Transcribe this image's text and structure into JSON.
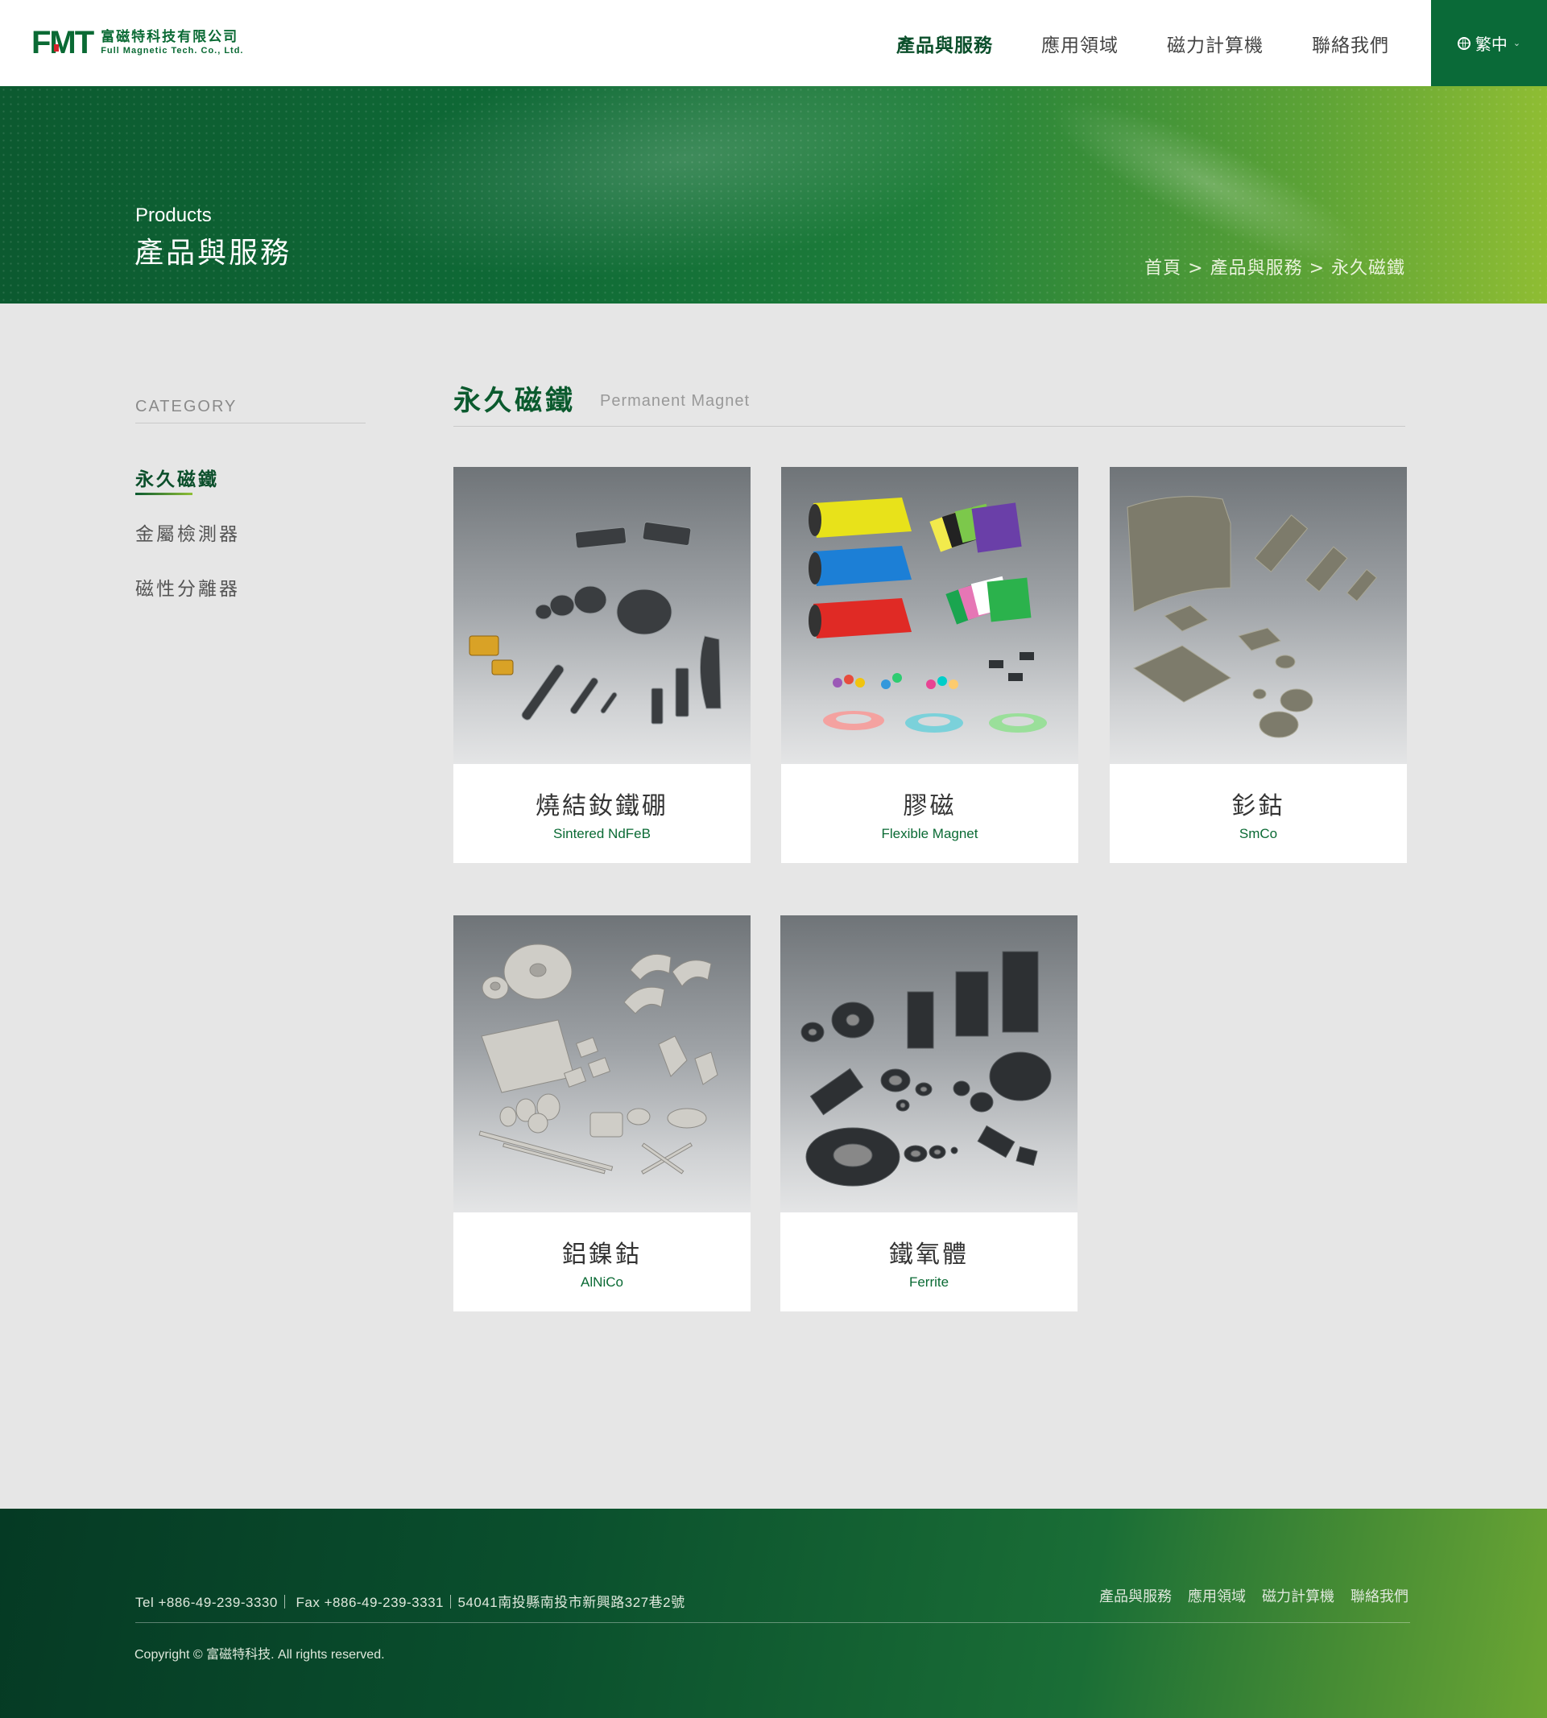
{
  "header": {
    "logo_mark": "FMT",
    "logo_cn": "富磁特科技有限公司",
    "logo_en": "Full Magnetic Tech. Co., Ltd.",
    "nav": [
      {
        "label": "產品與服務",
        "active": true
      },
      {
        "label": "應用領域",
        "active": false
      },
      {
        "label": "磁力計算機",
        "active": false
      },
      {
        "label": "聯絡我們",
        "active": false
      }
    ],
    "language": "繁中"
  },
  "banner": {
    "title_en": "Products",
    "title_cn": "產品與服務",
    "breadcrumb": "首頁 > 產品與服務 > 永久磁鐵"
  },
  "sidebar": {
    "title": "CATEGORY",
    "items": [
      {
        "label": "永久磁鐵",
        "active": true
      },
      {
        "label": "金屬檢測器",
        "active": false
      },
      {
        "label": "磁性分離器",
        "active": false
      }
    ]
  },
  "main": {
    "title_cn": "永久磁鐵",
    "title_en": "Permanent Magnet",
    "products": [
      {
        "cn": "燒結釹鐵硼",
        "en": "Sintered NdFeB"
      },
      {
        "cn": "膠磁",
        "en": "Flexible Magnet"
      },
      {
        "cn": "釤鈷",
        "en": "SmCo"
      },
      {
        "cn": "鋁鎳鈷",
        "en": "AlNiCo"
      },
      {
        "cn": "鐵氧體",
        "en": "Ferrite"
      }
    ]
  },
  "footer": {
    "contact": "Tel +886-49-239-3330｜ Fax +886-49-239-3331｜54041南投縣南投市新興路327巷2號",
    "nav": [
      "產品與服務",
      "應用領域",
      "磁力計算機",
      "聯絡我們"
    ],
    "copyright": "Copyright © 富磁特科技. All rights reserved."
  },
  "colors": {
    "brand_green": "#0a6a34",
    "dark_green": "#0b4f2b",
    "accent_lime": "#8fbd33",
    "page_bg": "#e6e6e6"
  }
}
